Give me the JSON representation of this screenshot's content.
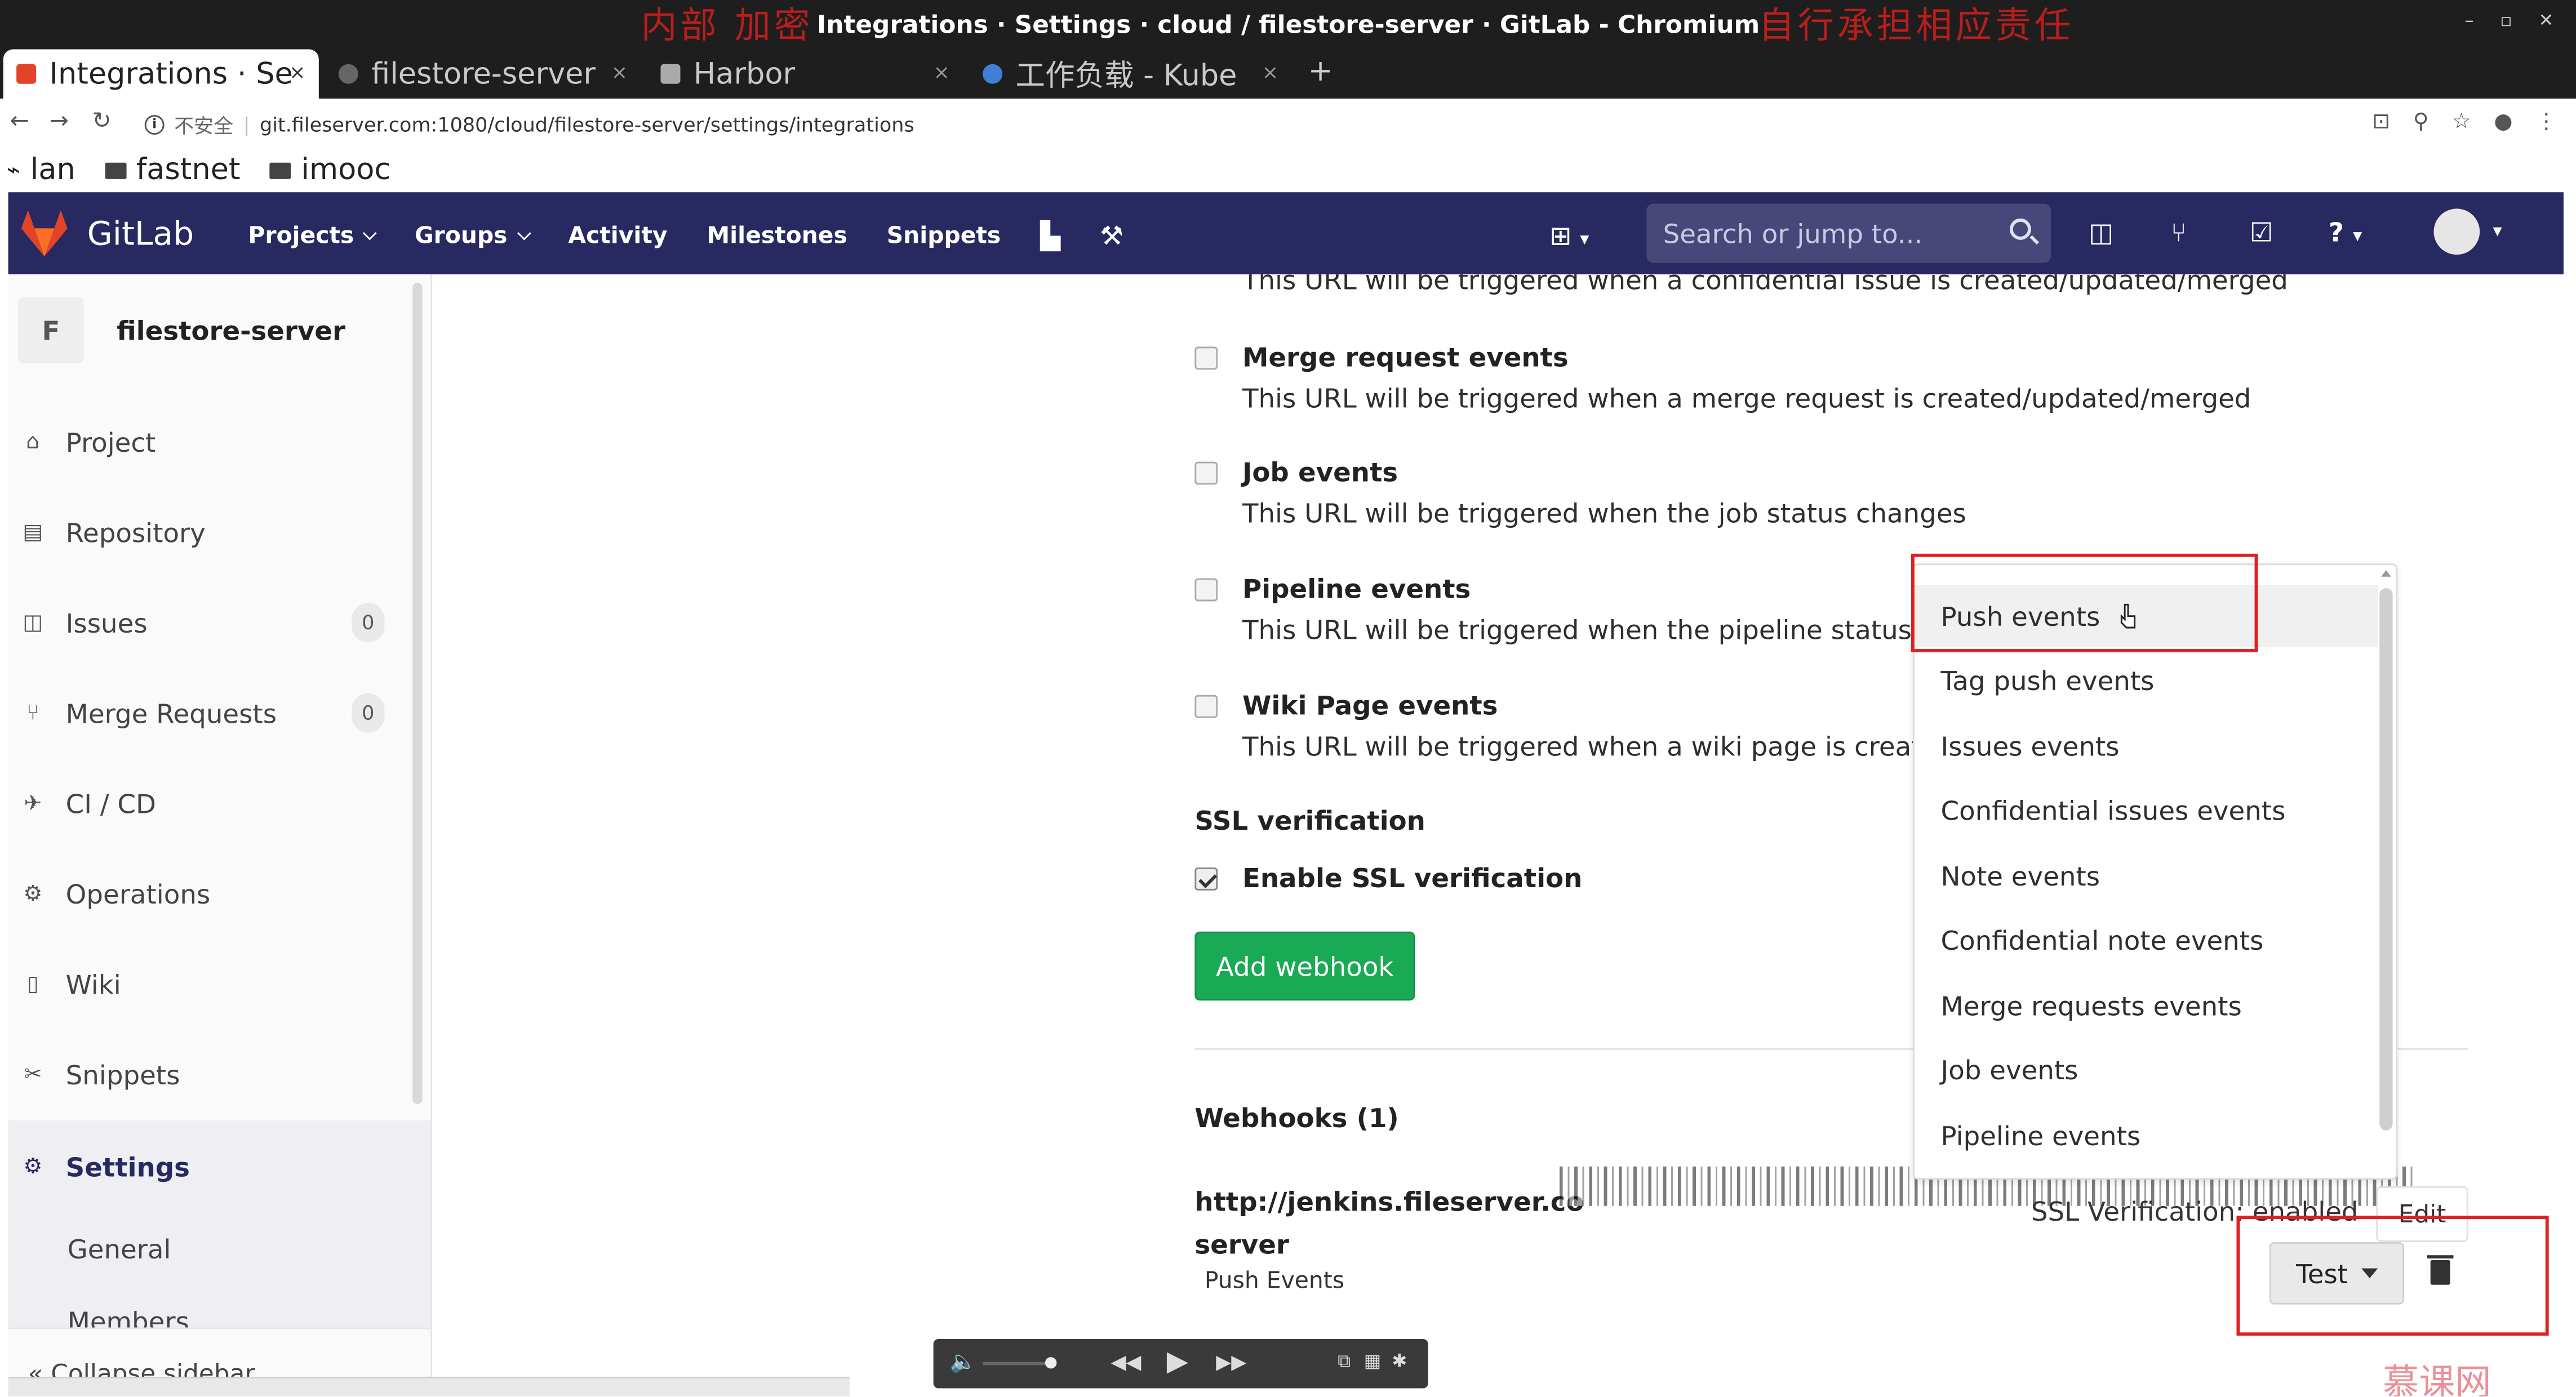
{
  "window": {
    "title": "Integrations · Settings · cloud / filestore-server · GitLab - Chromium",
    "watermark_left": "内部 加密",
    "watermark_right": "自行承担相应责任",
    "minimize": "–",
    "restore": "▫",
    "close": "✕"
  },
  "tabs": [
    {
      "label": "Integrations · Se",
      "favicon_color": "#e24329"
    },
    {
      "label": "filestore-server",
      "favicon_color": "#666666"
    },
    {
      "label": "Harbor",
      "favicon_color": "#aaaaaa"
    },
    {
      "label": "工作负载 - Kube",
      "favicon_color": "#3f7fd6"
    }
  ],
  "tab_close": "×",
  "new_tab": "+",
  "address": {
    "security_label": "不安全",
    "separator": "|",
    "url": "git.fileserver.com:1080/cloud/filestore-server/settings/integrations"
  },
  "nav_icons": {
    "back": "←",
    "forward": "→",
    "reload": "↻",
    "info": "i"
  },
  "toolbar_icons": {
    "translate": "⊡",
    "zoom": "⚲",
    "star": "☆",
    "profile": "●",
    "menu": "⋮"
  },
  "bookmarks": [
    {
      "label": "lan",
      "icon": "⌁"
    },
    {
      "label": "fastnet",
      "icon": "folder"
    },
    {
      "label": "imooc",
      "icon": "folder"
    }
  ],
  "gitlab": {
    "brand": "GitLab",
    "nav": [
      {
        "label": "Projects",
        "dropdown": true
      },
      {
        "label": "Groups",
        "dropdown": true
      },
      {
        "label": "Activity",
        "dropdown": false
      },
      {
        "label": "Milestones",
        "dropdown": false
      },
      {
        "label": "Snippets",
        "dropdown": false
      }
    ],
    "nav_icon_glyphs": {
      "chart": "▙",
      "wrench": "⚒",
      "plus": "⊞",
      "issues": "◫",
      "merge": "⑂",
      "todo": "☑",
      "help": "?",
      "caret": "▾"
    },
    "search_placeholder": "Search or jump to...",
    "colors": {
      "header": "#292961",
      "accent": "#292961",
      "green": "#1aaa55"
    }
  },
  "sidebar": {
    "project_initial": "F",
    "project_name": "filestore-server",
    "items": [
      {
        "label": "Project",
        "icon": "⌂"
      },
      {
        "label": "Repository",
        "icon": "▤"
      },
      {
        "label": "Issues",
        "icon": "◫",
        "badge": "0"
      },
      {
        "label": "Merge Requests",
        "icon": "⑂",
        "badge": "0"
      },
      {
        "label": "CI / CD",
        "icon": "✈"
      },
      {
        "label": "Operations",
        "icon": "⚙"
      },
      {
        "label": "Wiki",
        "icon": "▯"
      },
      {
        "label": "Snippets",
        "icon": "✂"
      },
      {
        "label": "Settings",
        "icon": "⚙"
      }
    ],
    "sub_items": [
      "General",
      "Members"
    ],
    "collapse_icon": "«",
    "collapse_label": "Collapse sidebar"
  },
  "main": {
    "truncated_top": "This URL will be triggered when a confidential issue is created/updated/merged",
    "events": [
      {
        "title": "Merge request events",
        "desc": "This URL will be triggered when a merge request is created/updated/merged",
        "checked": false
      },
      {
        "title": "Job events",
        "desc": "This URL will be triggered when the job status changes",
        "checked": false
      },
      {
        "title": "Pipeline events",
        "desc": "This URL will be triggered when the pipeline status c",
        "checked": false
      },
      {
        "title": "Wiki Page events",
        "desc": "This URL will be triggered when a wiki page is create",
        "checked": false
      }
    ],
    "ssl_heading": "SSL verification",
    "ssl_label": "Enable SSL verification",
    "ssl_checked": true,
    "add_webhook": "Add webhook",
    "webhooks_heading": "Webhooks (1)",
    "webhook": {
      "url_line1": "http://jenkins.fileserver.co",
      "url_line2": "server",
      "events_text": "Push Events",
      "ssl_status": "SSL Verification: enabled",
      "edit": "Edit",
      "test": "Test"
    },
    "test_dropdown": [
      "Push events",
      "Tag push events",
      "Issues events",
      "Confidential issues events",
      "Note events",
      "Confidential note events",
      "Merge requests events",
      "Job events",
      "Pipeline events"
    ]
  },
  "player": {
    "volume": "🔈",
    "rewind": "◀◀",
    "play": "▶",
    "forward": "▶▶",
    "pip": "⧉",
    "list": "▦",
    "settings": "✱"
  },
  "corner_watermark": "慕课网"
}
